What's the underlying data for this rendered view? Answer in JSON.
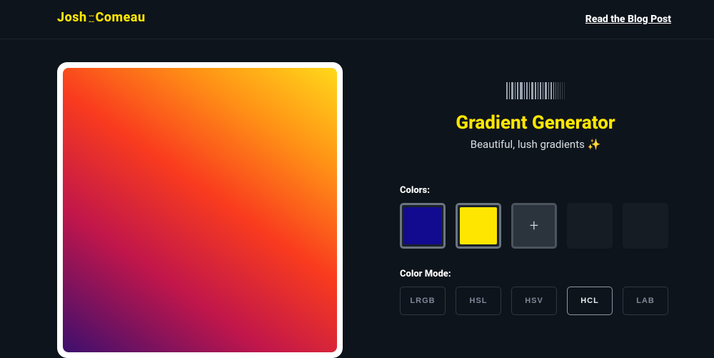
{
  "header": {
    "logo_left": "Josh",
    "logo_right": "Comeau",
    "blog_link": "Read the Blog Post"
  },
  "hero": {
    "title": "Gradient Generator",
    "subtitle": "Beautiful, lush gradients ✨"
  },
  "colors": {
    "label": "Colors:",
    "swatches": [
      "#120a8f",
      "#ffe600"
    ],
    "add_symbol": "+"
  },
  "mode": {
    "label": "Color Mode:",
    "options": [
      "LRGB",
      "HSL",
      "HSV",
      "HCL",
      "LAB"
    ],
    "active": "HCL"
  }
}
